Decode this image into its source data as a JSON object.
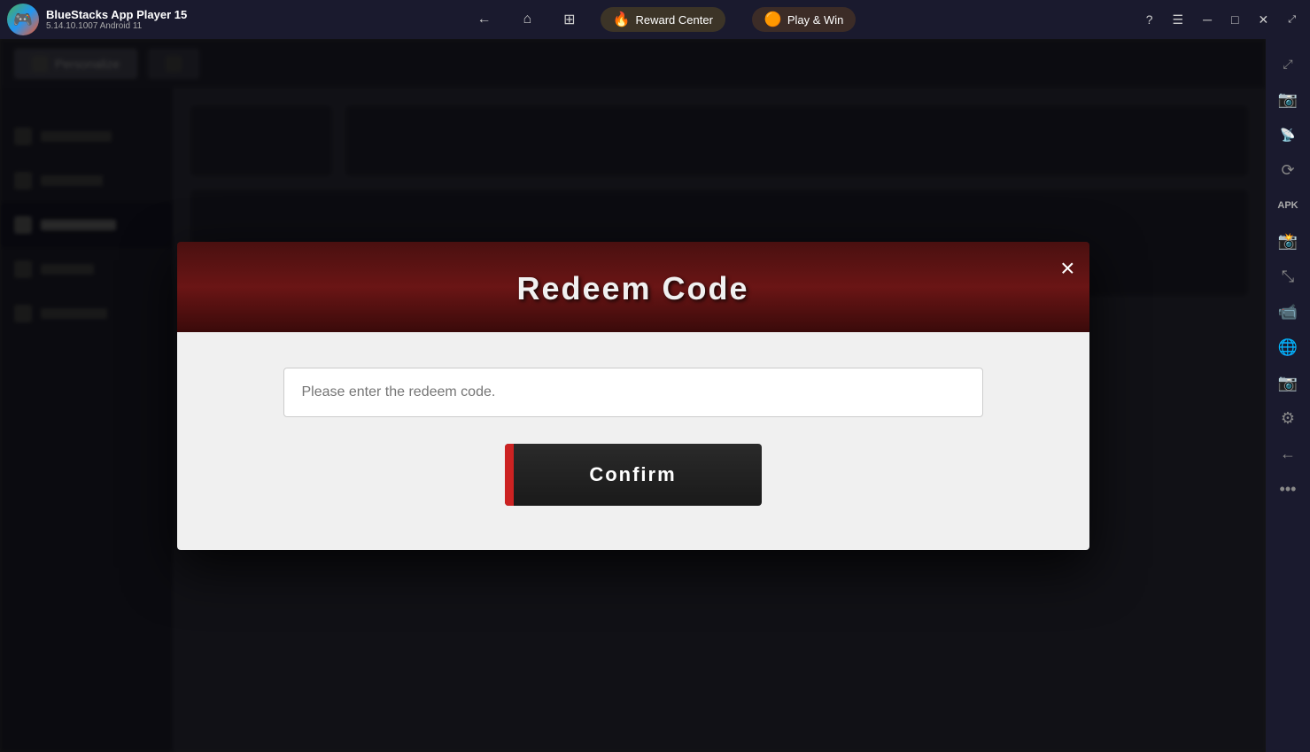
{
  "titleBar": {
    "appName": "BlueStacks App Player 15",
    "appVersion": "5.14.10.1007  Android 11",
    "rewardCenter": "Reward Center",
    "playAndWin": "Play & Win",
    "navButtons": [
      "←",
      "⌂",
      "⊞"
    ]
  },
  "modal": {
    "title": "Redeem Code",
    "closeButton": "×",
    "inputPlaceholder": "Please enter the redeem code.",
    "confirmButton": "Confirm"
  },
  "rightSidebar": {
    "icons": [
      "⤢",
      "📷",
      "📷",
      "⟳",
      "APK",
      "📸",
      "⤡",
      "📷",
      "🌐",
      "📷",
      "⚙",
      "←",
      "•••"
    ]
  },
  "leftSidebar": {
    "items": [
      {
        "label": "Personalize",
        "active": false
      },
      {
        "label": "Accounts",
        "active": false
      },
      {
        "label": "Multi-Display",
        "active": false
      },
      {
        "label": "Home Mode",
        "active": true
      },
      {
        "label": "Engine",
        "active": false
      },
      {
        "label": "Advanced",
        "active": false
      }
    ]
  }
}
